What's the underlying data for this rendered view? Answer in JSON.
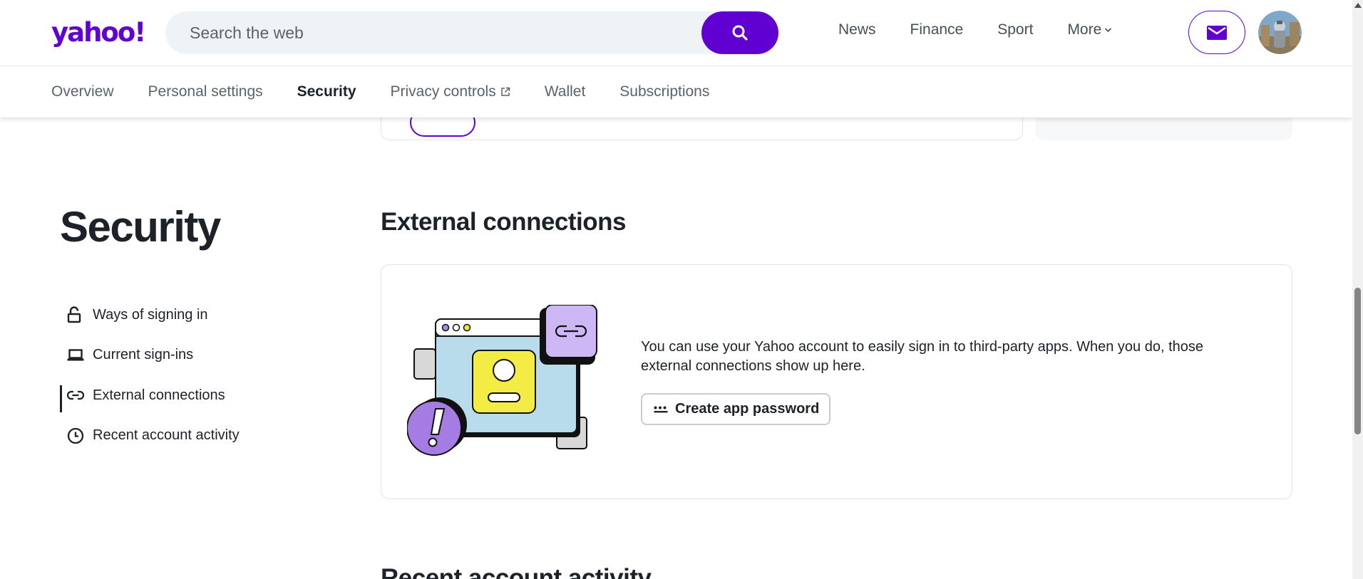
{
  "header": {
    "logo": "yahoo!",
    "search_placeholder": "Search the web",
    "nav": [
      {
        "label": "News"
      },
      {
        "label": "Finance"
      },
      {
        "label": "Sport"
      },
      {
        "label": "More"
      }
    ]
  },
  "tabs": [
    {
      "label": "Overview"
    },
    {
      "label": "Personal settings"
    },
    {
      "label": "Security"
    },
    {
      "label": "Privacy controls"
    },
    {
      "label": "Wallet"
    },
    {
      "label": "Subscriptions"
    }
  ],
  "active_tab": "Security",
  "sidebar": {
    "heading": "Security",
    "items": [
      {
        "label": "Ways of signing in",
        "icon": "unlock-icon"
      },
      {
        "label": "Current sign-ins",
        "icon": "laptop-icon"
      },
      {
        "label": "External connections",
        "icon": "link-icon"
      },
      {
        "label": "Recent account activity",
        "icon": "clock-icon"
      }
    ],
    "active_item": "External connections"
  },
  "main": {
    "section_title": "External connections",
    "description": "You can use your Yahoo account to easily sign in to third-party apps. When you do, those external connections show up here.",
    "button_label": "Create app password",
    "next_section_title": "Recent account activity"
  },
  "colors": {
    "brand": "#6001d2",
    "text": "#1d2228",
    "muted": "#5b636a"
  }
}
